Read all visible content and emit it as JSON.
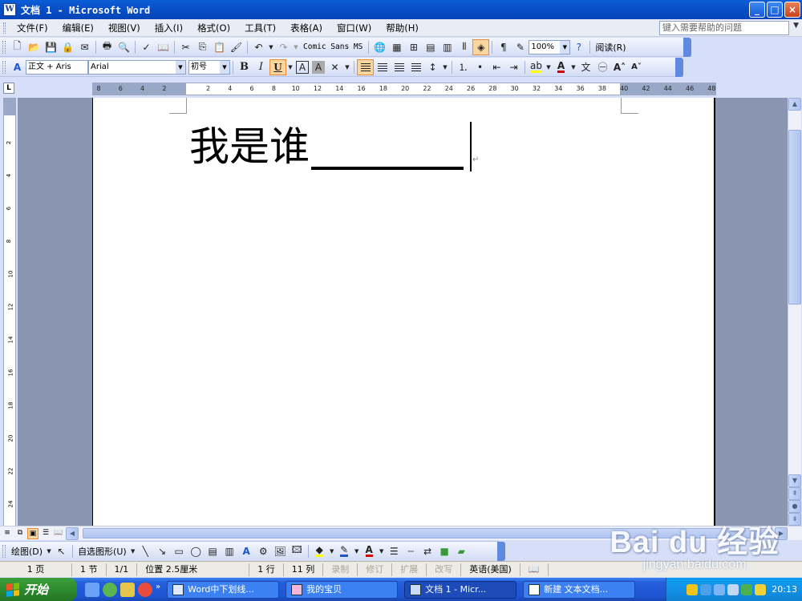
{
  "window": {
    "title": "文档 1 - Microsoft Word",
    "app_icon": "W",
    "controls": [
      "_",
      "□",
      "×"
    ]
  },
  "menubar": {
    "items": [
      "文件(F)",
      "编辑(E)",
      "视图(V)",
      "插入(I)",
      "格式(O)",
      "工具(T)",
      "表格(A)",
      "窗口(W)",
      "帮助(H)"
    ],
    "help_placeholder": "键入需要帮助的问题"
  },
  "standard_toolbar": {
    "font_preview": "Comic Sans MS",
    "zoom": "100%",
    "read_label": "阅读(R)"
  },
  "formatting_toolbar": {
    "style": "正文 + Aris",
    "font": "Arial",
    "size": "初号",
    "bold": "B",
    "italic": "I",
    "underline": "U",
    "font_color": "#d00000",
    "highlight_color": "#ffff00"
  },
  "ruler": {
    "corner": "L",
    "ticks": [
      "8",
      "6",
      "4",
      "2",
      "",
      "2",
      "4",
      "6",
      "8",
      "10",
      "12",
      "14",
      "16",
      "18",
      "20",
      "22",
      "24",
      "26",
      "28",
      "30",
      "32",
      "34",
      "36",
      "38",
      "40",
      "42",
      "44",
      "46",
      "48"
    ],
    "vticks": [
      "2",
      "4",
      "6",
      "8",
      "10",
      "12",
      "14",
      "16",
      "18",
      "20",
      "22",
      "24"
    ]
  },
  "document": {
    "text": "我是谁"
  },
  "drawing_toolbar": {
    "draw_label": "绘图(D)",
    "autoshapes_label": "自选图形(U)"
  },
  "statusbar": {
    "page": "1 页",
    "section": "1 节",
    "page_of": "1/1",
    "position": "位置 2.5厘米",
    "line": "1 行",
    "column": "11 列",
    "rec": "录制",
    "trk": "修订",
    "ext": "扩展",
    "ovr": "改写",
    "language": "英语(美国)"
  },
  "taskbar": {
    "start_label": "开始",
    "tasks": [
      {
        "label": "Word中下划线...",
        "active": false
      },
      {
        "label": "我的宝贝",
        "active": false
      },
      {
        "label": "文档 1 - Micr...",
        "active": true
      },
      {
        "label": "新建 文本文档...",
        "active": false
      }
    ],
    "clock": "20:13"
  },
  "watermark": {
    "main": "Bai du 经验",
    "sub": "jingyan.baidu.com"
  }
}
